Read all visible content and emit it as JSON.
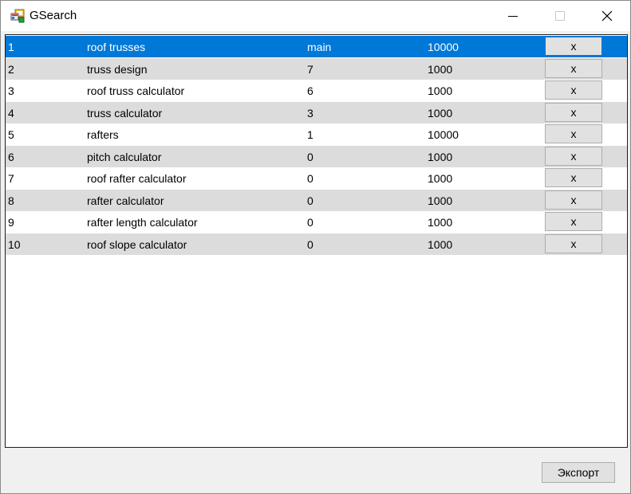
{
  "window": {
    "title": "GSearch",
    "icon": "app-window-icon",
    "controls": {
      "minimize": "minimize-icon",
      "maximize": "maximize-icon",
      "close": "close-icon"
    }
  },
  "table": {
    "rows": [
      {
        "num": "1",
        "keyword": "roof trusses",
        "position": "main",
        "volume": "10000",
        "action": "x",
        "selected": true
      },
      {
        "num": "2",
        "keyword": "truss design",
        "position": "7",
        "volume": "1000",
        "action": "x"
      },
      {
        "num": "3",
        "keyword": "roof truss calculator",
        "position": "6",
        "volume": "1000",
        "action": "x"
      },
      {
        "num": "4",
        "keyword": "truss calculator",
        "position": "3",
        "volume": "1000",
        "action": "x"
      },
      {
        "num": "5",
        "keyword": "rafters",
        "position": "1",
        "volume": "10000",
        "action": "x"
      },
      {
        "num": "6",
        "keyword": "pitch calculator",
        "position": "0",
        "volume": "1000",
        "action": "x"
      },
      {
        "num": "7",
        "keyword": "roof rafter calculator",
        "position": "0",
        "volume": "1000",
        "action": "x"
      },
      {
        "num": "8",
        "keyword": "rafter calculator",
        "position": "0",
        "volume": "1000",
        "action": "x"
      },
      {
        "num": "9",
        "keyword": "rafter length calculator",
        "position": "0",
        "volume": "1000",
        "action": "x"
      },
      {
        "num": "10",
        "keyword": "roof slope calculator",
        "position": "0",
        "volume": "1000",
        "action": "x"
      }
    ]
  },
  "footer": {
    "export_label": "Экспорт"
  },
  "colors": {
    "selection": "#0078d7",
    "row_alt": "#dcdcdc",
    "row_white": "#ffffff",
    "window_bg": "#f0f0f0"
  }
}
